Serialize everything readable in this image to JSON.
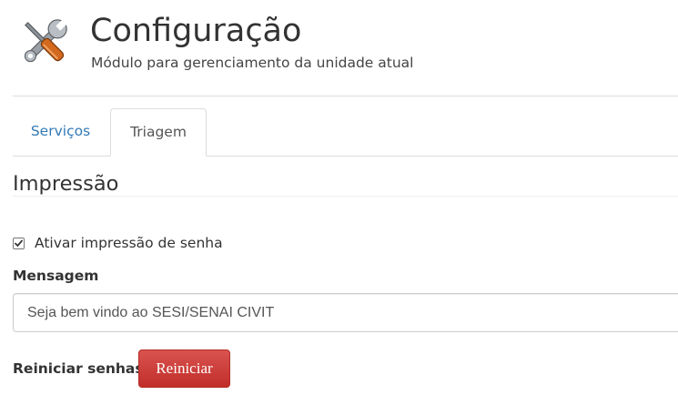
{
  "header": {
    "icon": "tools-icon",
    "title": "Configuração",
    "subtitle": "Módulo para gerenciamento da unidade atual"
  },
  "tabs": [
    {
      "label": "Serviços",
      "active": false
    },
    {
      "label": "Triagem",
      "active": true
    }
  ],
  "section": {
    "title": "Impressão"
  },
  "print_toggle": {
    "label": "Ativar impressão de senha",
    "checked": true
  },
  "message": {
    "label": "Mensagem",
    "value": "Seja bem vindo ao SESI/SENAI CIVIT"
  },
  "reset": {
    "label": "Reiniciar senhas",
    "button_label": "Reiniciar"
  },
  "colors": {
    "link": "#337ab7",
    "danger": "#d9534f"
  }
}
